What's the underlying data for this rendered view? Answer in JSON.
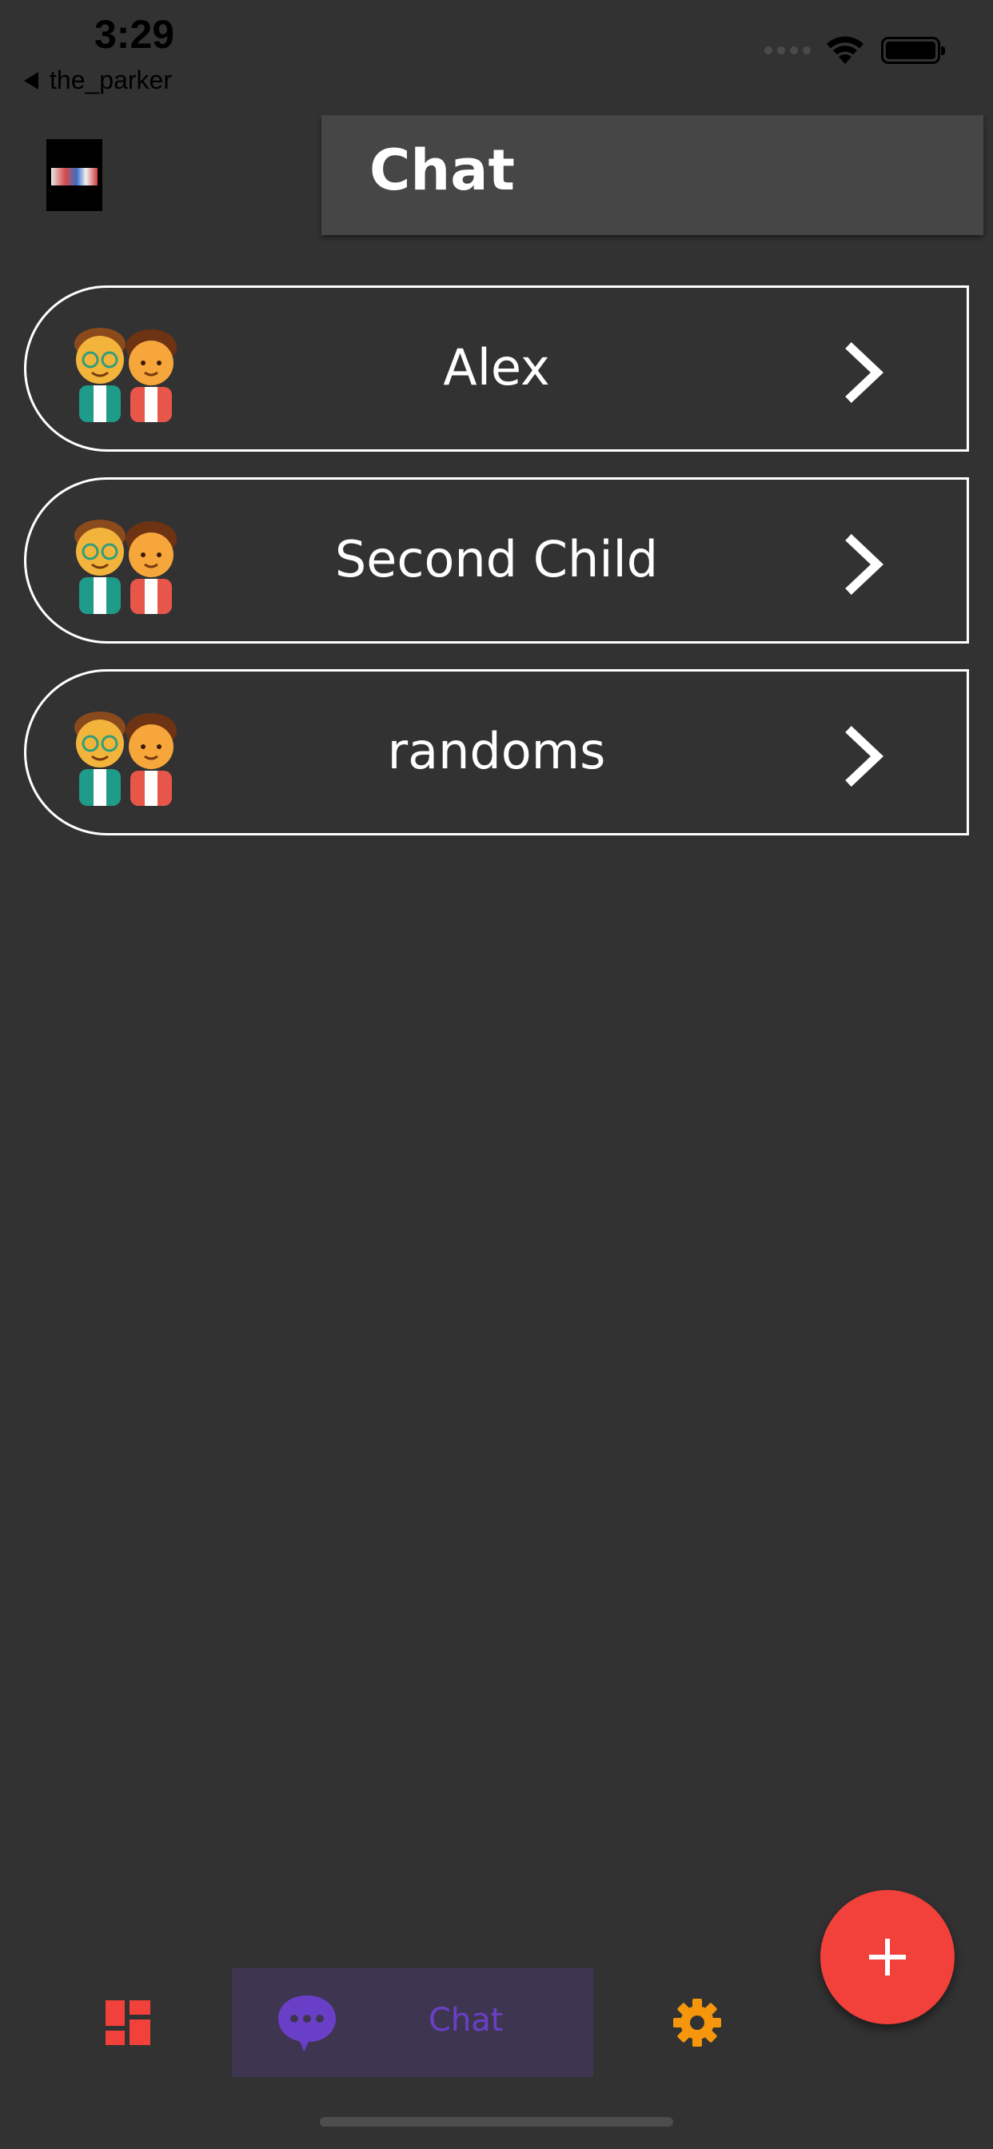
{
  "status_bar": {
    "time": "3:29",
    "back_label": "the_parker"
  },
  "header": {
    "title": "Chat"
  },
  "chats": [
    {
      "name": "Alex"
    },
    {
      "name": "Second Child"
    },
    {
      "name": "randoms"
    }
  ],
  "fab": {
    "icon": "plus-icon"
  },
  "bottom_nav": {
    "items": [
      {
        "icon": "dashboard-icon",
        "label": ""
      },
      {
        "icon": "chat-bubble-icon",
        "label": "Chat",
        "active": true
      },
      {
        "icon": "gear-icon",
        "label": ""
      }
    ]
  },
  "colors": {
    "background": "#323232",
    "title_panel": "#464646",
    "accent_red": "#f2403a",
    "active_nav": "#6a3fc8",
    "active_nav_bg": "#3e3650",
    "settings_orange": "#f5960c"
  }
}
